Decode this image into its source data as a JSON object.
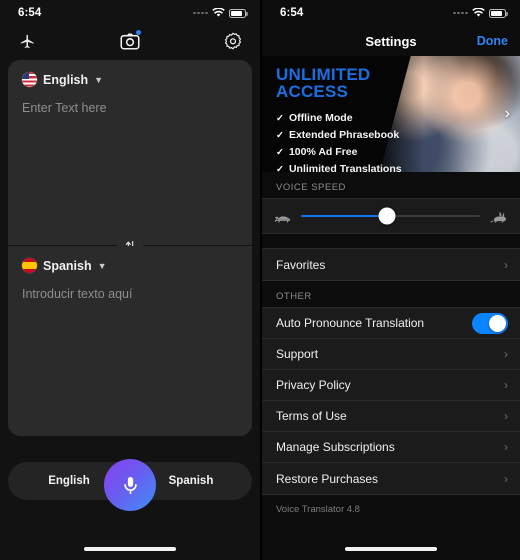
{
  "status_bar": {
    "time": "6:54"
  },
  "left_screen": {
    "toolbar": {
      "airplane_label": "airplane-mode",
      "camera_label": "camera-translate",
      "settings_label": "settings"
    },
    "source": {
      "language": "English",
      "flag": "us-flag-icon",
      "placeholder": "Enter Text here",
      "value": ""
    },
    "target": {
      "language": "Spanish",
      "flag": "es-flag-icon",
      "placeholder": "Introducir texto aquí",
      "value": ""
    },
    "swap_label": "swap-languages",
    "bottom_bar": {
      "left_language": "English",
      "right_language": "Spanish",
      "mic_label": "record-voice"
    }
  },
  "right_screen": {
    "nav": {
      "title": "Settings",
      "done_label": "Done"
    },
    "promo": {
      "headline_line1": "UNLIMITED",
      "headline_line2": "ACCESS",
      "features": [
        "Offline Mode",
        "Extended Phrasebook",
        "100% Ad Free",
        "Unlimited Translations"
      ],
      "check_glyph": "✓",
      "chevron": "›",
      "accent_color": "#1a6fe0"
    },
    "voice_speed": {
      "header": "VOICE SPEED",
      "value_percent": 48,
      "slow_icon": "turtle-icon",
      "fast_icon": "rabbit-icon",
      "fill_color": "#1273ef"
    },
    "favorites": {
      "label": "Favorites",
      "chevron": "›"
    },
    "other_header": "OTHER",
    "other_rows": [
      {
        "label": "Auto Pronounce Translation",
        "type": "toggle",
        "value": "on"
      },
      {
        "label": "Support",
        "type": "link",
        "chevron": "›"
      },
      {
        "label": "Privacy Policy",
        "type": "link",
        "chevron": "›"
      },
      {
        "label": "Terms of Use",
        "type": "link",
        "chevron": "›"
      },
      {
        "label": "Manage Subscriptions",
        "type": "link",
        "chevron": "›"
      },
      {
        "label": "Restore Purchases",
        "type": "link",
        "chevron": "›"
      }
    ],
    "version": "Voice Translator 4.8"
  }
}
